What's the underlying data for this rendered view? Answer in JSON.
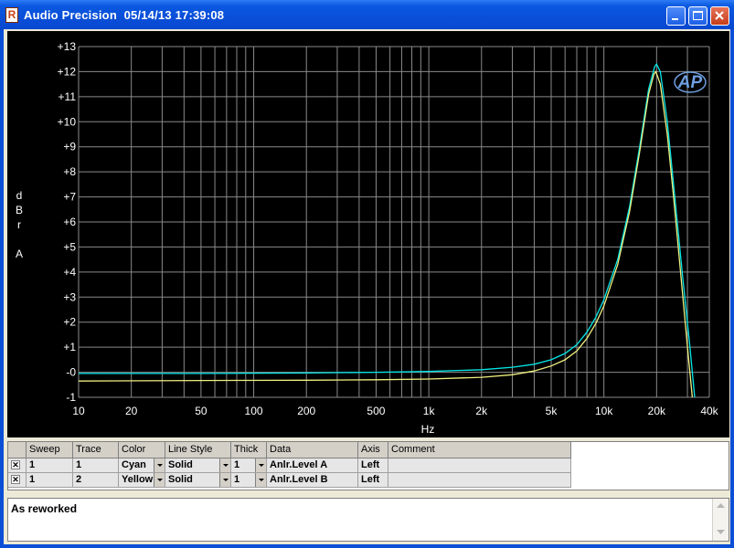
{
  "window": {
    "title": "Audio Precision  05/14/13 17:39:08",
    "buttons": [
      "minimize",
      "maximize",
      "close"
    ]
  },
  "chart_data": {
    "type": "line",
    "title": "",
    "xlabel": "Hz",
    "ylabel": "dBr A",
    "x_scale": "log",
    "xlim": [
      10,
      40000
    ],
    "ylim": [
      -1,
      13
    ],
    "grid": true,
    "logo": "AP",
    "x_tick_labels": [
      "10",
      "20",
      "50",
      "100",
      "200",
      "500",
      "1k",
      "2k",
      "5k",
      "10k",
      "20k",
      "40k"
    ],
    "x_tick_values": [
      10,
      20,
      50,
      100,
      200,
      500,
      1000,
      2000,
      5000,
      10000,
      20000,
      40000
    ],
    "y_tick_labels": [
      "-1",
      "-0",
      "+1",
      "+2",
      "+3",
      "+4",
      "+5",
      "+6",
      "+7",
      "+8",
      "+9",
      "+10",
      "+11",
      "+12",
      "+13"
    ],
    "y_tick_values": [
      -1,
      0,
      1,
      2,
      3,
      4,
      5,
      6,
      7,
      8,
      9,
      10,
      11,
      12,
      13
    ],
    "series": [
      {
        "color": "#00e8e8",
        "points": [
          [
            10,
            -0.05
          ],
          [
            50,
            -0.05
          ],
          [
            200,
            -0.03
          ],
          [
            500,
            0.0
          ],
          [
            1000,
            0.03
          ],
          [
            2000,
            0.1
          ],
          [
            3000,
            0.2
          ],
          [
            4000,
            0.32
          ],
          [
            5000,
            0.5
          ],
          [
            6000,
            0.75
          ],
          [
            7000,
            1.1
          ],
          [
            8000,
            1.6
          ],
          [
            9000,
            2.2
          ],
          [
            10000,
            2.9
          ],
          [
            12000,
            4.5
          ],
          [
            14000,
            6.6
          ],
          [
            16000,
            9.0
          ],
          [
            18000,
            11.3
          ],
          [
            19500,
            12.2
          ],
          [
            20000,
            12.3
          ],
          [
            21000,
            12.0
          ],
          [
            23000,
            10.0
          ],
          [
            25000,
            7.5
          ],
          [
            28000,
            4.0
          ],
          [
            31000,
            1.0
          ],
          [
            33000,
            -1.0
          ]
        ]
      },
      {
        "color": "#f0f080",
        "points": [
          [
            10,
            -0.35
          ],
          [
            50,
            -0.33
          ],
          [
            200,
            -0.32
          ],
          [
            500,
            -0.3
          ],
          [
            1000,
            -0.27
          ],
          [
            2000,
            -0.2
          ],
          [
            3000,
            -0.1
          ],
          [
            4000,
            0.05
          ],
          [
            5000,
            0.25
          ],
          [
            6000,
            0.5
          ],
          [
            7000,
            0.85
          ],
          [
            8000,
            1.35
          ],
          [
            9000,
            1.95
          ],
          [
            10000,
            2.65
          ],
          [
            12000,
            4.3
          ],
          [
            14000,
            6.4
          ],
          [
            16000,
            8.8
          ],
          [
            18000,
            11.1
          ],
          [
            19300,
            11.9
          ],
          [
            19800,
            12.0
          ],
          [
            21000,
            11.5
          ],
          [
            23000,
            9.5
          ],
          [
            25000,
            7.0
          ],
          [
            28000,
            3.3
          ],
          [
            30500,
            0.5
          ],
          [
            32000,
            -1.0
          ]
        ]
      }
    ]
  },
  "trace_table": {
    "columns": [
      "Sweep",
      "Trace",
      "Color",
      "Line Style",
      "Thick",
      "Data",
      "Axis",
      "Comment"
    ],
    "rows": [
      {
        "checked": true,
        "sweep": "1",
        "trace": "1",
        "color": "Cyan",
        "line_style": "Solid",
        "thick": "1",
        "data": "Anlr.Level A",
        "axis": "Left",
        "comment": ""
      },
      {
        "checked": true,
        "sweep": "1",
        "trace": "2",
        "color": "Yellow",
        "line_style": "Solid",
        "thick": "1",
        "data": "Anlr.Level B",
        "axis": "Left",
        "comment": ""
      }
    ]
  },
  "comment": {
    "text": "As reworked"
  }
}
